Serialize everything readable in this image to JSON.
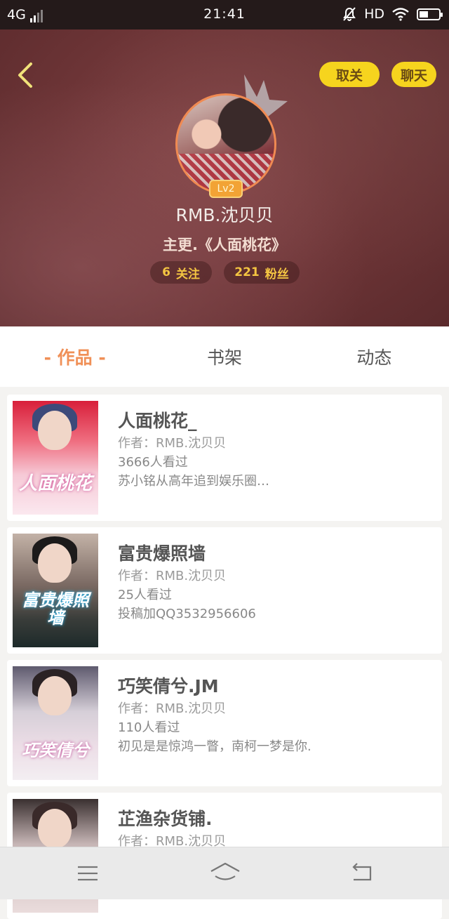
{
  "status_bar": {
    "network": "4G",
    "time": "21:41",
    "hd": "HD"
  },
  "profile": {
    "unfollow_label": "取关",
    "chat_label": "聊天",
    "level": "Lv2",
    "nickname": "RMB.沈贝贝",
    "subtitle": "主更.《人面桃花》",
    "following_count": "6",
    "following_label": "关注",
    "fans_count": "221",
    "fans_label": "粉丝"
  },
  "tabs": [
    {
      "label": "- 作品 -",
      "active": true
    },
    {
      "label": "书架",
      "active": false
    },
    {
      "label": "动态",
      "active": false
    }
  ],
  "books": [
    {
      "title": "人面桃花_",
      "author": "作者：RMB.沈贝贝",
      "views": "3666人看过",
      "desc": "苏小铭从高年追到娱乐圈…",
      "cover_title": "人面桃花"
    },
    {
      "title": "富贵爆照墙",
      "author": "作者：RMB.沈贝贝",
      "views": "25人看过",
      "desc": "投稿加QQ3532956606",
      "cover_title": "富贵爆照墙"
    },
    {
      "title": "巧笑倩兮.JM",
      "author": "作者：RMB.沈贝贝",
      "views": "110人看过",
      "desc": "初见是是惊鸿一瞥，南柯一梦是你.",
      "cover_title": "巧笑倩兮"
    },
    {
      "title": "芷渔杂货铺.",
      "author": "作者：RMB.沈贝贝",
      "views": "",
      "desc": "",
      "cover_title": ""
    }
  ],
  "colors": {
    "accent_yellow": "#f6d41e",
    "tab_active": "#f09057",
    "avatar_ring": "#f08a52"
  },
  "icons": [
    "signal-icon",
    "mute-icon",
    "wifi-icon",
    "battery-icon",
    "back-icon",
    "crown-icon",
    "menu-icon",
    "home-icon",
    "return-icon"
  ]
}
